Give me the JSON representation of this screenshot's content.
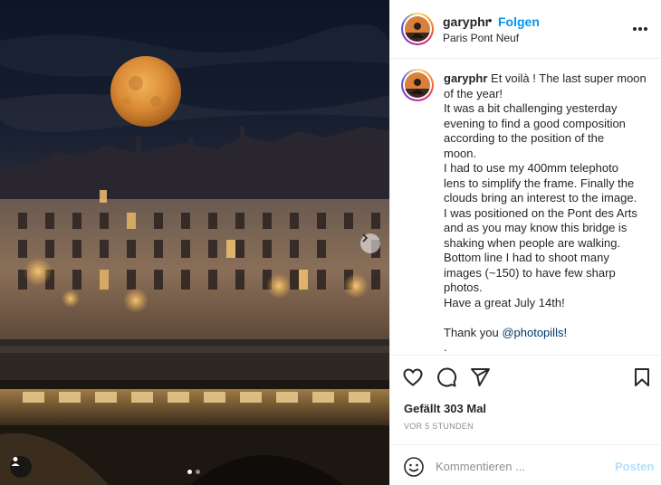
{
  "post": {
    "username": "garyphr",
    "separator": "•",
    "follow_label": "Folgen",
    "location": "Paris Pont Neuf"
  },
  "caption": {
    "username": "garyphr",
    "lines": [
      "Et voilà ! The last super moon",
      "of the year!",
      "It was a bit challenging yesterday",
      "evening to find a good composition",
      "according to the position of the",
      "moon.",
      "I had to use my 400mm telephoto",
      "lens to simplify the frame. Finally the",
      "clouds bring an interest to the image.",
      "I was positioned on the Pont des Arts",
      "and as you may know this bridge is",
      "shaking when people are walking.",
      "Bottom line I had to shoot many",
      "images (~150) to have few sharp",
      "photos.",
      "Have a great July 14th!",
      ""
    ],
    "thanks_prefix": "Thank you ",
    "mention": "@photopills",
    "thanks_suffix": "!",
    "trailing": "."
  },
  "engagement": {
    "likes": "Gefällt 303 Mal",
    "time_ago": "VOR 5 STUNDEN"
  },
  "comment": {
    "placeholder": "Kommentieren ...",
    "post_label": "Posten"
  },
  "carousel": {
    "slide_count": 2,
    "active_index": 0
  },
  "icons": {
    "like": "heart-icon",
    "comment": "comment-icon",
    "share": "paper-plane-icon",
    "save": "bookmark-icon",
    "more": "more-options-icon",
    "next": "chevron-right-icon",
    "tag": "user-tag-icon",
    "emoji": "emoji-icon"
  },
  "colors": {
    "follow": "#0095f6",
    "mention": "#00376b",
    "post_disabled": "#b2dffc",
    "meta": "#8e8e8e"
  }
}
